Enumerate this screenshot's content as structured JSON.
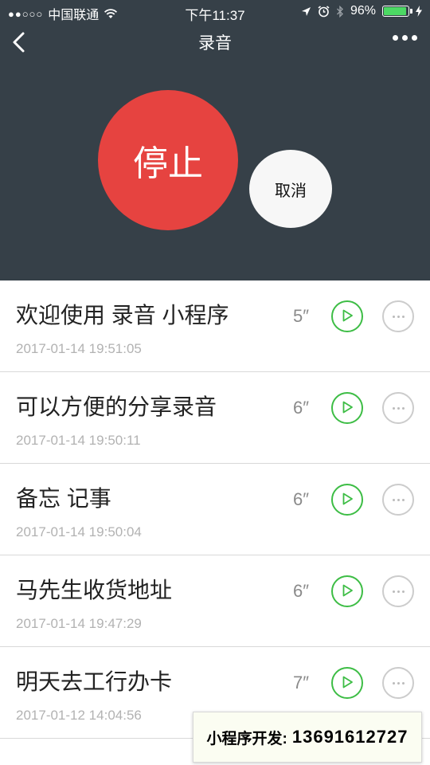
{
  "status_bar": {
    "signal": "●●○○○",
    "carrier": "中国联通",
    "time": "下午11:37",
    "battery": "96%"
  },
  "nav": {
    "title": "录音"
  },
  "controls": {
    "stop_label": "停止",
    "cancel_label": "取消"
  },
  "recordings": [
    {
      "title": "欢迎使用 录音 小程序",
      "time": "2017-01-14 19:51:05",
      "duration": "5″"
    },
    {
      "title": "可以方便的分享录音",
      "time": "2017-01-14 19:50:11",
      "duration": "6″"
    },
    {
      "title": "备忘 记事",
      "time": "2017-01-14 19:50:04",
      "duration": "6″"
    },
    {
      "title": "马先生收货地址",
      "time": "2017-01-14 19:47:29",
      "duration": "6″"
    },
    {
      "title": "明天去工行办卡",
      "time": "2017-01-12 14:04:56",
      "duration": "7″"
    }
  ],
  "promo": {
    "label": "小程序开发:",
    "phone": "13691612727"
  },
  "colors": {
    "header_bg": "#364048",
    "stop": "#e64340",
    "play": "#3dbd45"
  }
}
